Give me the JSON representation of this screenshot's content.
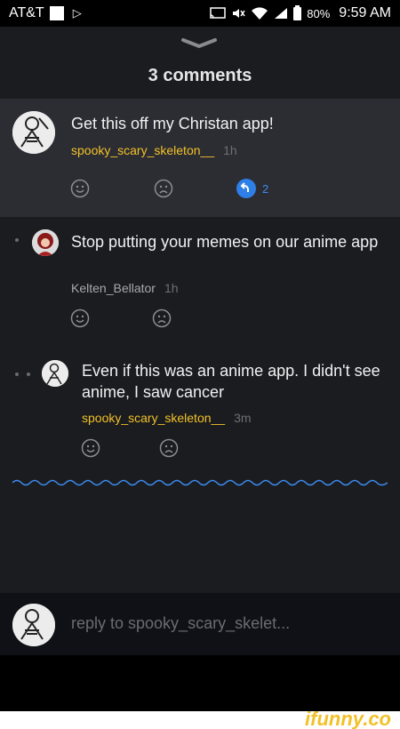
{
  "status_bar": {
    "carrier": "AT&T",
    "battery_pct": "80%",
    "time": "9:59 AM"
  },
  "sheet": {
    "title": "3 comments"
  },
  "comments": [
    {
      "text": "Get this off my Christan app!",
      "user": "spooky_scary_skeleton__",
      "time": "1h",
      "replies": "2"
    },
    {
      "text": "Stop putting your memes on our anime app",
      "user": "Kelten_Bellator",
      "time": "1h"
    },
    {
      "text": "Even if this was an anime app. I didn't see anime, I saw cancer",
      "user": "spooky_scary_skeleton__",
      "time": "3m"
    }
  ],
  "reply_input": {
    "placeholder": "reply to spooky_scary_skelet..."
  },
  "watermark": "ifunny.co",
  "colors": {
    "sheet_bg": "#1b1c20",
    "highlight_bg": "#2c2d33",
    "username_yellow": "#f2c128",
    "accent_blue": "#3c8cf0"
  },
  "icons": [
    "cast-icon",
    "mute-icon",
    "wifi-icon",
    "signal-icon",
    "battery-icon",
    "smile-icon",
    "frown-icon",
    "reply-icon",
    "chevron-down-icon"
  ]
}
